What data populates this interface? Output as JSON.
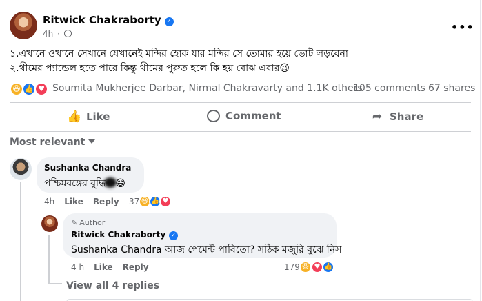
{
  "post": {
    "author": "Ritwick Chakraborty",
    "time": "4h",
    "menu_label": "•••",
    "lines": [
      "১.এখানে ওখানে সেখানে যেখানেই মন্দির হোক যার মন্দির সে তোমার হয়ে ভোট লড়বেনা",
      "২.থীমের প্যান্ডেল হতে পারে কিন্তু থীমের পুরুত হলে কি হয় বোঝ এবার😉"
    ]
  },
  "reactions": {
    "names": "Soumita Mukherjee Darbar, Nirmal Chakravarty and 1.1K others",
    "comments": "105 comments",
    "shares": "67 shares"
  },
  "actions": {
    "like": "Like",
    "comment": "Comment",
    "share": "Share"
  },
  "sort": {
    "label": "Most relevant"
  },
  "comments": [
    {
      "author": "Sushanka Chandra",
      "text_before": "পশ্চিমবঙ্গের বুদ্ধি",
      "text_after": "😄",
      "time": "4h",
      "like": "Like",
      "reply": "Reply",
      "react_count": "37"
    }
  ],
  "reply": {
    "tag": "Author",
    "author": "Ritwick Chakraborty",
    "mention": "Sushanka Chandra",
    "text": " আজ পেমেন্ট পাবিতো? সঠিক মজুরি বুঝে নিস",
    "time": "4 h",
    "like": "Like",
    "reply": "Reply",
    "react_count": "179"
  },
  "view_all": "View all 4 replies",
  "colors": {
    "accent": "#1877f2",
    "muted": "#65676b",
    "bubble": "#f0f2f5",
    "love": "#f33e58",
    "haha": "#f7b125"
  }
}
